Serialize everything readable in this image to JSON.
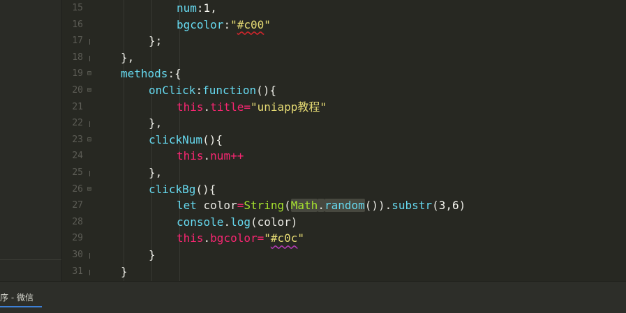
{
  "editor": {
    "lines": [
      {
        "num": "15",
        "fold": "",
        "segments": [
          {
            "t": "num",
            "c": "k"
          },
          {
            "t": ":",
            "c": "p"
          },
          {
            "t": "1",
            "c": "n"
          },
          {
            "t": ",",
            "c": "p"
          }
        ],
        "indent": 5
      },
      {
        "num": "16",
        "fold": "",
        "segments": [
          {
            "t": "bgcolor",
            "c": "k"
          },
          {
            "t": ":",
            "c": "p"
          },
          {
            "t": "\"",
            "c": "s"
          },
          {
            "t": "#c00",
            "c": "s sq-red"
          },
          {
            "t": "\"",
            "c": "s"
          }
        ],
        "indent": 5
      },
      {
        "num": "17",
        "fold": "line",
        "segments": [
          {
            "t": "};",
            "c": "p"
          }
        ],
        "indent": 4
      },
      {
        "num": "18",
        "fold": "line",
        "segments": [
          {
            "t": "},",
            "c": "p"
          }
        ],
        "indent": 3
      },
      {
        "num": "19",
        "fold": "box",
        "segments": [
          {
            "t": "methods",
            "c": "k"
          },
          {
            "t": ":{",
            "c": "p"
          }
        ],
        "indent": 3
      },
      {
        "num": "20",
        "fold": "box",
        "segments": [
          {
            "t": "onClick",
            "c": "k"
          },
          {
            "t": ":",
            "c": "p"
          },
          {
            "t": "function",
            "c": "k"
          },
          {
            "t": "(){",
            "c": "p"
          }
        ],
        "indent": 4
      },
      {
        "num": "21",
        "fold": "",
        "segments": [
          {
            "t": "this",
            "c": "kw"
          },
          {
            "t": ".",
            "c": "p"
          },
          {
            "t": "title",
            "c": "kw"
          },
          {
            "t": "=",
            "c": "kw"
          },
          {
            "t": "\"uniapp教程\"",
            "c": "s"
          }
        ],
        "indent": 5
      },
      {
        "num": "22",
        "fold": "line",
        "segments": [
          {
            "t": "},",
            "c": "p"
          }
        ],
        "indent": 4
      },
      {
        "num": "23",
        "fold": "box",
        "segments": [
          {
            "t": "clickNum",
            "c": "k"
          },
          {
            "t": "(){",
            "c": "p"
          }
        ],
        "indent": 4
      },
      {
        "num": "24",
        "fold": "",
        "segments": [
          {
            "t": "this",
            "c": "kw"
          },
          {
            "t": ".",
            "c": "p"
          },
          {
            "t": "num",
            "c": "kw"
          },
          {
            "t": "++",
            "c": "kw"
          }
        ],
        "indent": 5
      },
      {
        "num": "25",
        "fold": "line",
        "segments": [
          {
            "t": "},",
            "c": "p"
          }
        ],
        "indent": 4
      },
      {
        "num": "26",
        "fold": "box",
        "segments": [
          {
            "t": "clickBg",
            "c": "k"
          },
          {
            "t": "(){",
            "c": "p"
          }
        ],
        "indent": 4
      },
      {
        "num": "27",
        "fold": "",
        "segments": [
          {
            "t": "let ",
            "c": "k"
          },
          {
            "t": "color",
            "c": "p"
          },
          {
            "t": "=",
            "c": "kw"
          },
          {
            "t": "String",
            "c": "f"
          },
          {
            "t": "(",
            "c": "p"
          },
          {
            "t": "Math",
            "c": "f hl"
          },
          {
            "t": ".",
            "c": "p hl"
          },
          {
            "t": "random",
            "c": "k hl"
          },
          {
            "t": "()",
            "c": "p"
          },
          {
            "t": ").",
            "c": "p"
          },
          {
            "t": "substr",
            "c": "k"
          },
          {
            "t": "(",
            "c": "p"
          },
          {
            "t": "3",
            "c": "n"
          },
          {
            "t": ",",
            "c": "p"
          },
          {
            "t": "6",
            "c": "n"
          },
          {
            "t": ")",
            "c": "p"
          }
        ],
        "indent": 5
      },
      {
        "num": "28",
        "fold": "",
        "segments": [
          {
            "t": "console",
            "c": "k"
          },
          {
            "t": ".",
            "c": "p"
          },
          {
            "t": "log",
            "c": "k"
          },
          {
            "t": "(color)",
            "c": "p"
          }
        ],
        "indent": 5
      },
      {
        "num": "29",
        "fold": "",
        "segments": [
          {
            "t": "this",
            "c": "kw"
          },
          {
            "t": ".",
            "c": "p"
          },
          {
            "t": "bgcolor",
            "c": "kw"
          },
          {
            "t": "=",
            "c": "kw"
          },
          {
            "t": "\"",
            "c": "s"
          },
          {
            "t": "#c0c",
            "c": "s sq-mag"
          },
          {
            "t": "\"",
            "c": "s"
          }
        ],
        "indent": 5
      },
      {
        "num": "30",
        "fold": "line",
        "segments": [
          {
            "t": "}",
            "c": "p"
          }
        ],
        "indent": 4
      },
      {
        "num": "31",
        "fold": "line",
        "segments": [
          {
            "t": "}",
            "c": "p"
          }
        ],
        "indent": 3
      }
    ]
  },
  "statusbar": {
    "task_label": "序 - 微信"
  },
  "colors": {
    "background": "#272822",
    "string": "#e6db74",
    "keyword": "#f92672",
    "property": "#66d9ef",
    "function": "#a6e22e"
  }
}
